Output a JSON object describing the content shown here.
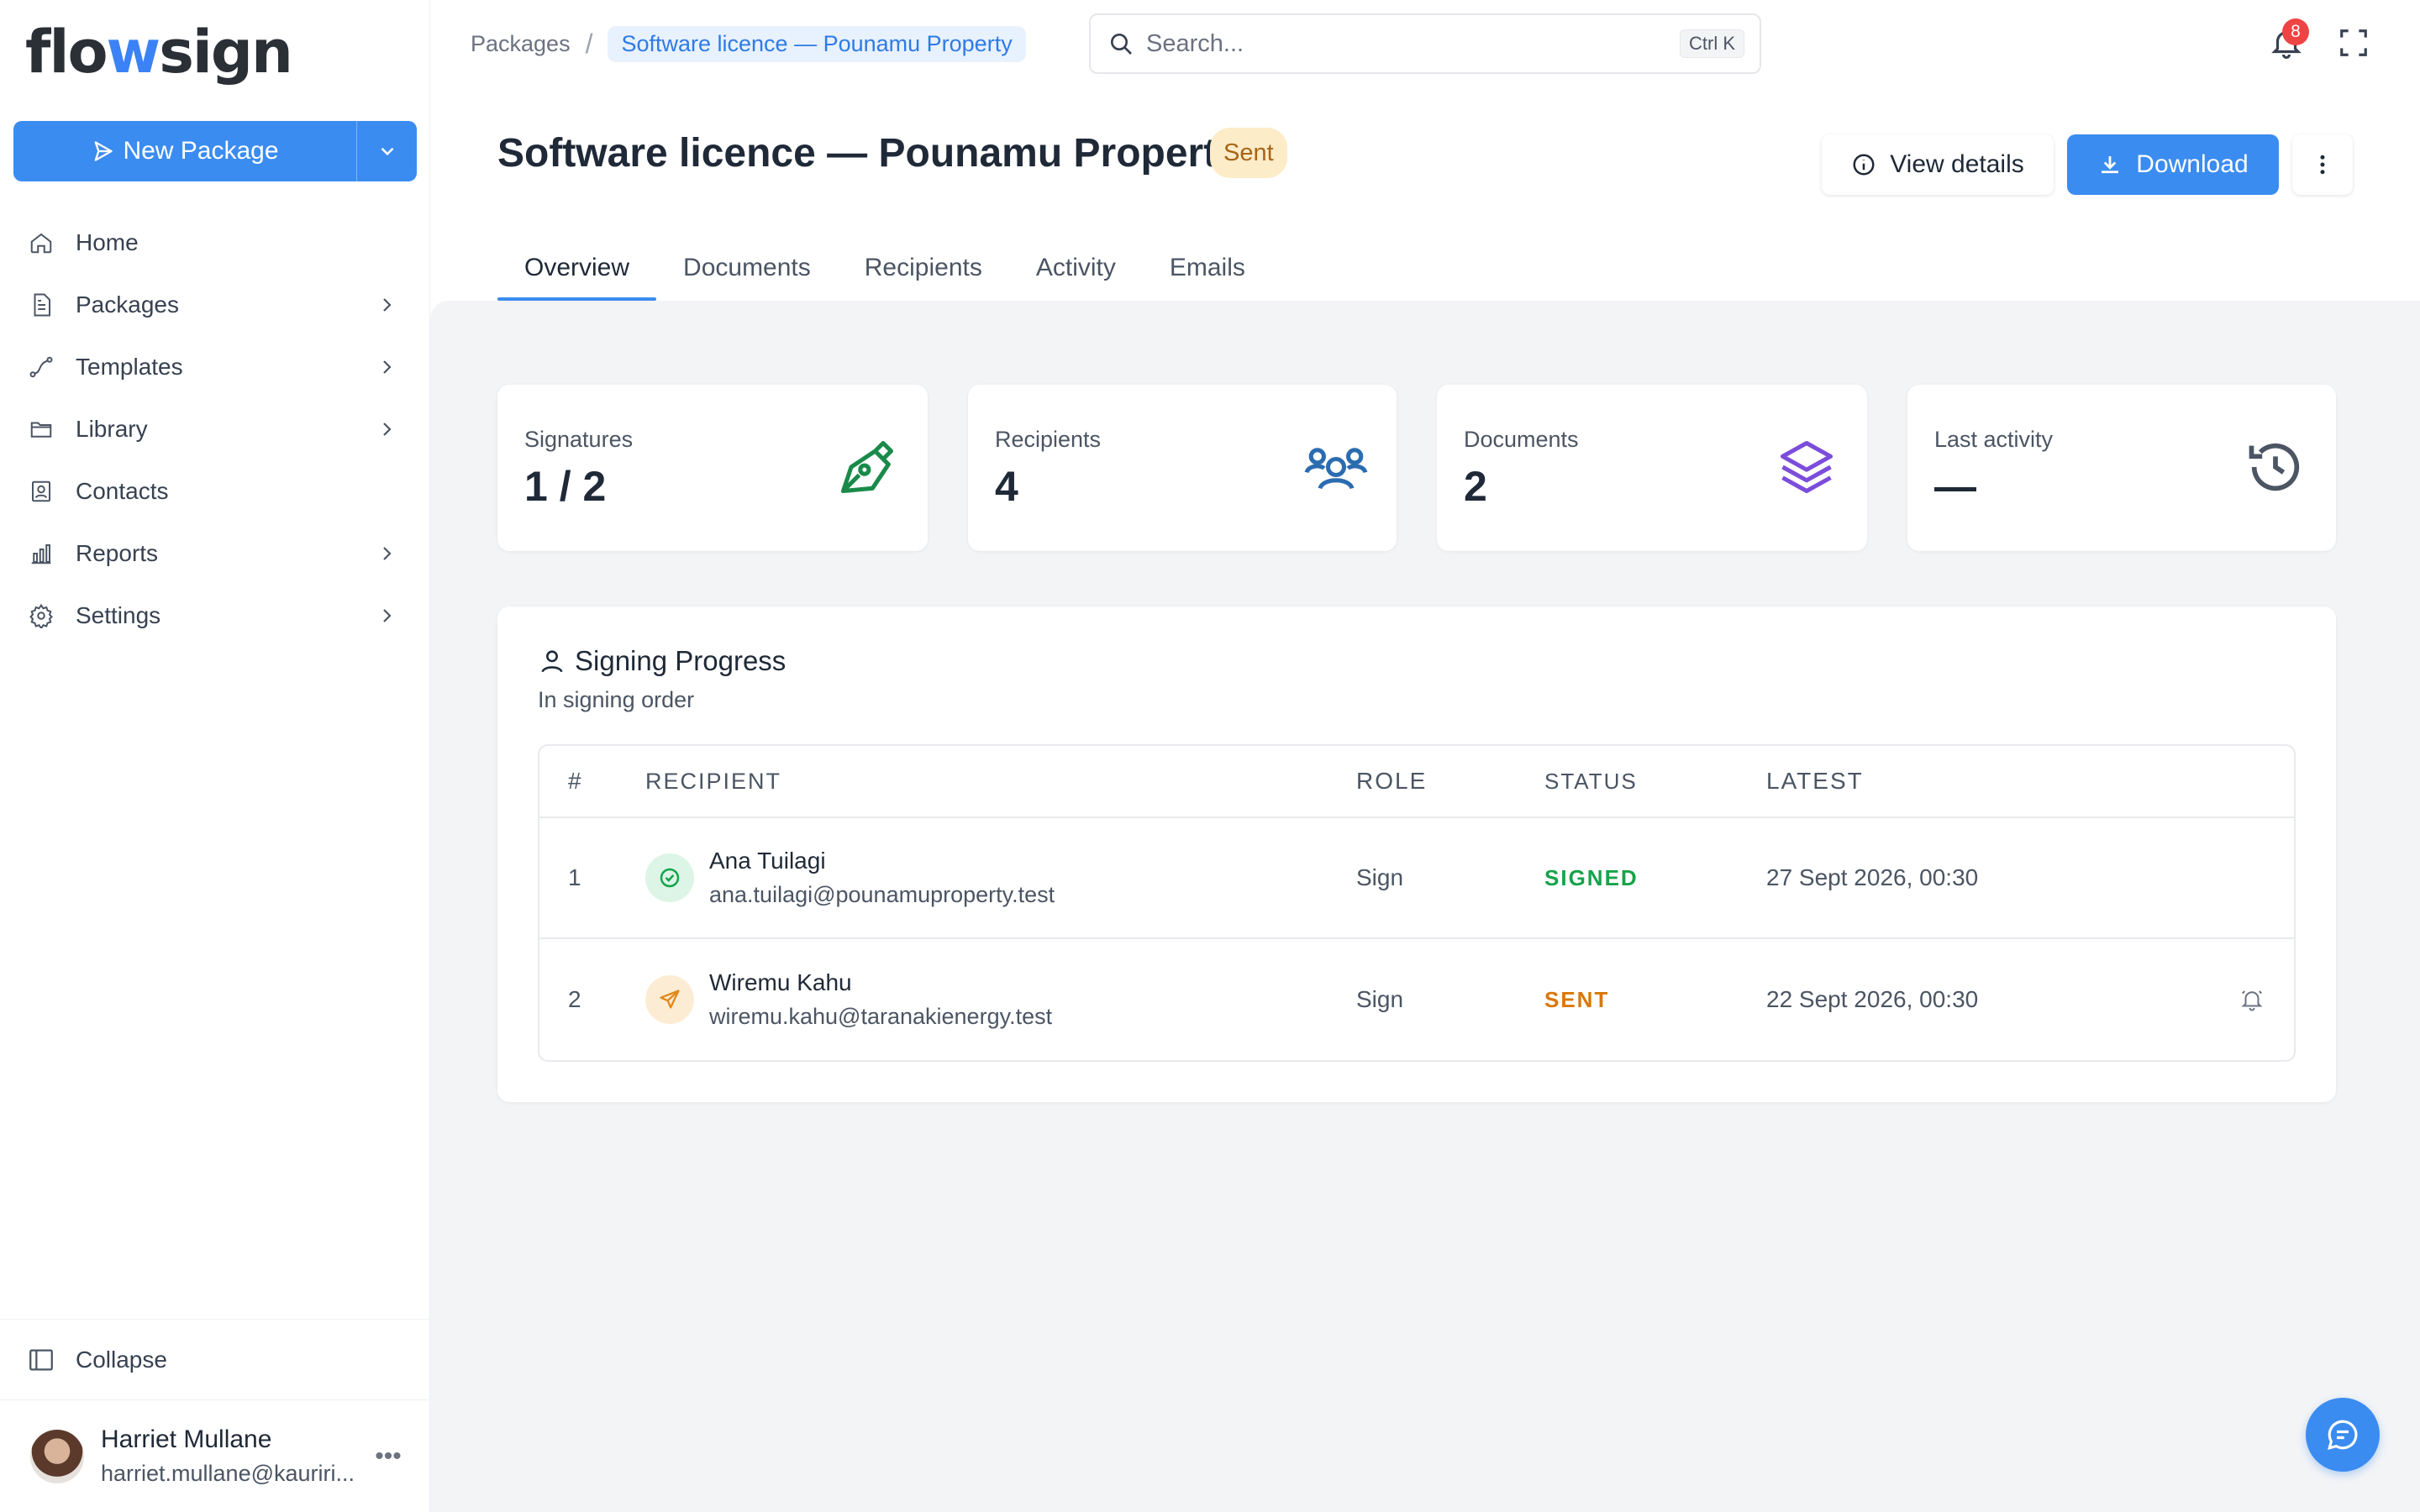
{
  "app": {
    "logo_text": "flowsign",
    "logo_parts": [
      "flo",
      "w",
      "sign"
    ]
  },
  "sidebar": {
    "new_package_label": "New Package",
    "items": [
      {
        "label": "Home",
        "icon": "home-icon",
        "has_chevron": false
      },
      {
        "label": "Packages",
        "icon": "document-icon",
        "has_chevron": true
      },
      {
        "label": "Templates",
        "icon": "route-icon",
        "has_chevron": true
      },
      {
        "label": "Library",
        "icon": "folder-icon",
        "has_chevron": true
      },
      {
        "label": "Contacts",
        "icon": "contacts-icon",
        "has_chevron": false
      },
      {
        "label": "Reports",
        "icon": "bar-chart-icon",
        "has_chevron": true
      },
      {
        "label": "Settings",
        "icon": "gear-icon",
        "has_chevron": true
      }
    ],
    "collapse_label": "Collapse",
    "user": {
      "name": "Harriet Mullane",
      "email": "harriet.mullane@kauriri..."
    }
  },
  "topbar": {
    "breadcrumb": [
      "Packages",
      "Software licence — Pounamu Property"
    ],
    "breadcrumb_separator": "/",
    "search_placeholder": "Search...",
    "search_shortcut": "Ctrl K",
    "notification_count": "8"
  },
  "header": {
    "title": "Software licence — Pounamu Property",
    "status": "Sent",
    "view_details_label": "View details",
    "download_label": "Download"
  },
  "tabs": [
    "Overview",
    "Documents",
    "Recipients",
    "Activity",
    "Emails"
  ],
  "active_tab": "Overview",
  "stats": [
    {
      "label": "Signatures",
      "value": "1 / 2",
      "icon": "pen-nib-icon",
      "color": "#1a8a4a"
    },
    {
      "label": "Recipients",
      "value": "4",
      "icon": "users-icon",
      "color": "#2b6cb0"
    },
    {
      "label": "Documents",
      "value": "2",
      "icon": "layers-icon",
      "color": "#7c4ddb"
    },
    {
      "label": "Last activity",
      "value": "—",
      "icon": "history-icon",
      "color": "#4b5563"
    }
  ],
  "progress": {
    "title": "Signing Progress",
    "subtitle": "In signing order",
    "columns": [
      "#",
      "RECIPIENT",
      "ROLE",
      "STATUS",
      "LATEST"
    ],
    "rows": [
      {
        "num": "1",
        "name": "Ana Tuilagi",
        "email": "ana.tuilagi@pounamuproperty.test",
        "role": "Sign",
        "status": "SIGNED",
        "latest": "27 Sept 2026, 00:30",
        "status_color": "#16a34a",
        "badge_icon": "check-circle-icon"
      },
      {
        "num": "2",
        "name": "Wiremu Kahu",
        "email": "wiremu.kahu@taranakienergy.test",
        "role": "Sign",
        "status": "SENT",
        "latest": "22 Sept 2026, 00:30",
        "status_color": "#d97706",
        "badge_icon": "send-icon"
      }
    ]
  },
  "colors": {
    "accent": "#3b8cf0",
    "sent_pill_bg": "#fdecc8",
    "sent_pill_text": "#a86516"
  }
}
